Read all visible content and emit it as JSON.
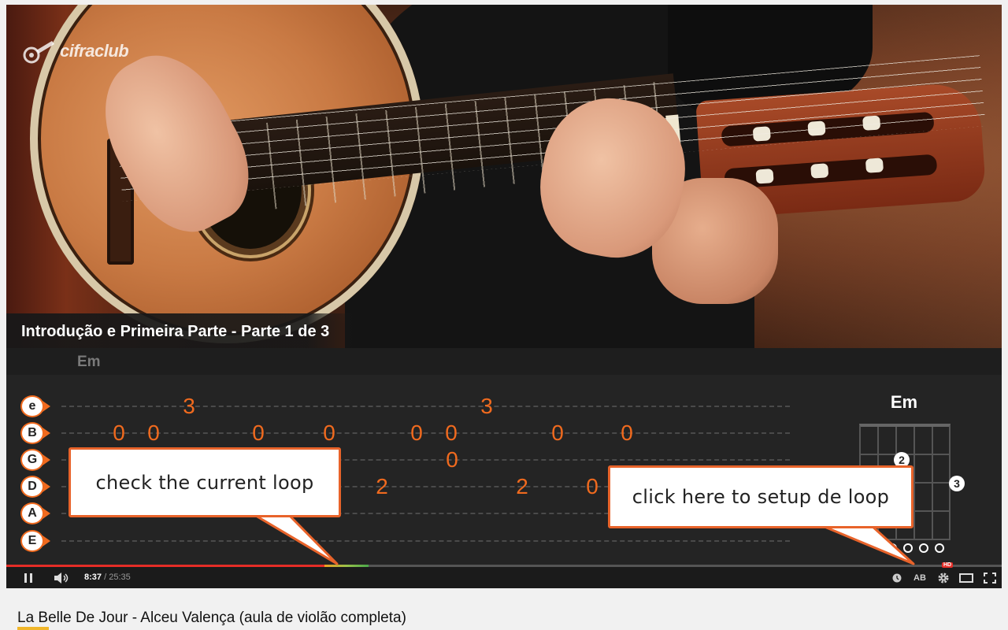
{
  "player": {
    "logo_text": "cifraclub",
    "video_title": "Introdução e Primeira Parte - Parte 1 de 3",
    "current_chord": "Em",
    "strings": [
      {
        "label": "e",
        "notes": [
          {
            "fret": "3",
            "pos": 232
          },
          {
            "fret": "3",
            "pos": 610
          }
        ]
      },
      {
        "label": "B",
        "notes": [
          {
            "fret": "0",
            "pos": 143
          },
          {
            "fret": "0",
            "pos": 187
          },
          {
            "fret": "0",
            "pos": 320
          },
          {
            "fret": "0",
            "pos": 410
          },
          {
            "fret": "0",
            "pos": 521
          },
          {
            "fret": "0",
            "pos": 565
          },
          {
            "fret": "0",
            "pos": 700
          },
          {
            "fret": "0",
            "pos": 788
          }
        ]
      },
      {
        "label": "G",
        "notes": [
          {
            "fret": "0",
            "pos": 566
          }
        ]
      },
      {
        "label": "D",
        "notes": [
          {
            "fret": "2",
            "pos": 477
          },
          {
            "fret": "2",
            "pos": 655
          },
          {
            "fret": "0",
            "pos": 744
          }
        ]
      },
      {
        "label": "A",
        "notes": []
      },
      {
        "label": "E",
        "notes": []
      }
    ],
    "chord_diagram": {
      "name": "Em",
      "fingers": [
        "2",
        "3"
      ],
      "page_dots": 4,
      "active_dot": 0
    },
    "progress": {
      "played_fraction": 0.33,
      "loop_start_fraction": 0.32,
      "loop_end_fraction": 0.364
    },
    "time": {
      "current": "8:37",
      "separator": " / ",
      "total": "25:35"
    },
    "controls": {
      "ab_label": "AB",
      "hd_label": "HD"
    }
  },
  "callouts": {
    "check_loop": "check the current loop",
    "setup_loop": "click here to setup de loop"
  },
  "page": {
    "title": "La Belle De Jour - Alceu Valença (aula de violão completa)"
  },
  "colors": {
    "accent_orange": "#f06a1e",
    "callout_border": "#e8632a",
    "progress_red": "#e52d27"
  }
}
